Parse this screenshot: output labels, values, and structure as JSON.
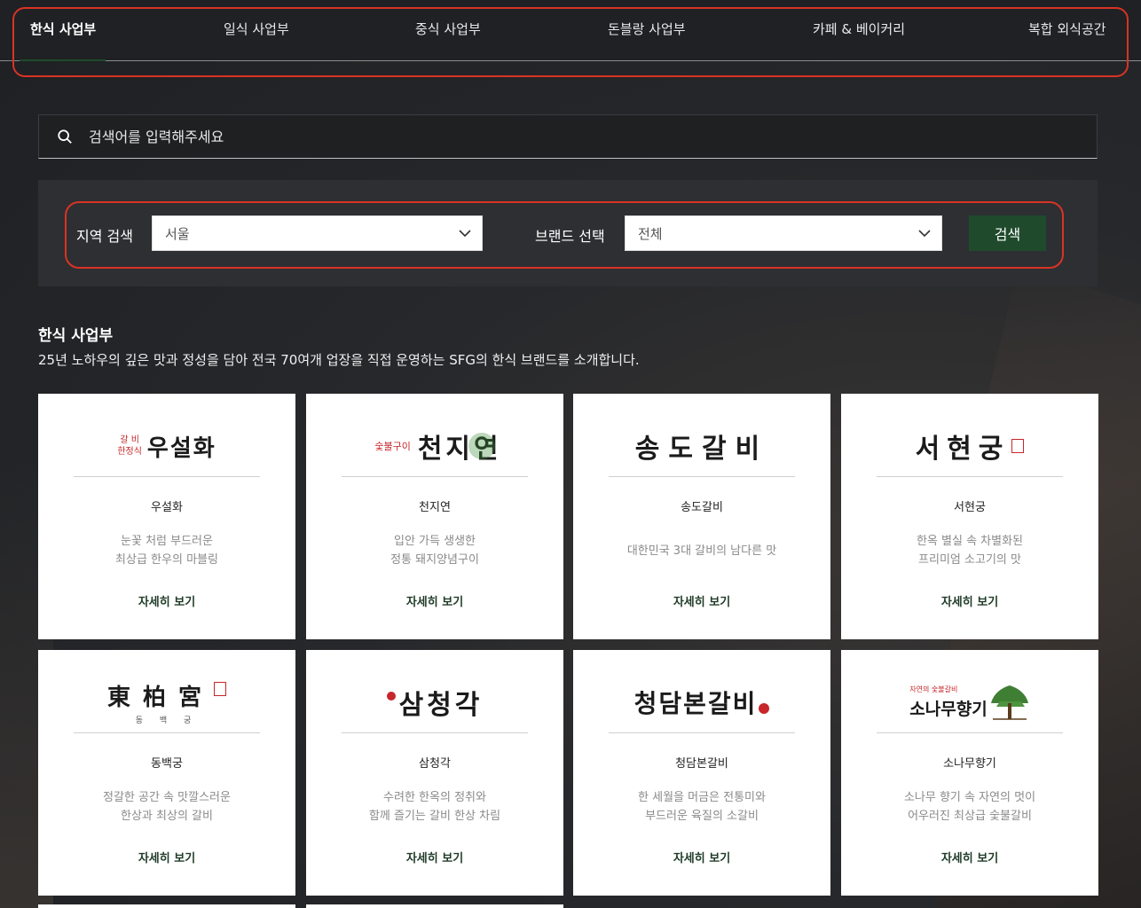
{
  "nav": {
    "tabs": [
      {
        "label": "한식 사업부",
        "active": true
      },
      {
        "label": "일식 사업부",
        "active": false
      },
      {
        "label": "중식 사업부",
        "active": false
      },
      {
        "label": "돈블랑 사업부",
        "active": false
      },
      {
        "label": "카페 & 베이커리",
        "active": false
      },
      {
        "label": "복합 외식공간",
        "active": false
      }
    ]
  },
  "search": {
    "placeholder": "검색어를 입력해주세요",
    "icon": "search-icon"
  },
  "filter": {
    "region_label": "지역 검색",
    "region_value": "서울",
    "brand_label": "브랜드 선택",
    "brand_value": "전체",
    "search_button": "검색"
  },
  "section": {
    "title": "한식 사업부",
    "description": "25년 노하우의 깊은 맛과 정성을 담아 전국 70여개 업장을 직접 운영하는 SFG의 한식 브랜드를 소개합니다."
  },
  "colors": {
    "accent": "#1f4b2c",
    "highlight": "#d93325"
  },
  "brands": [
    {
      "name": "우설화",
      "desc": [
        "눈꽃 처럼 부드러운",
        "최상급 한우의 마블링"
      ],
      "link": "자세히 보기",
      "logo": {
        "main": "우설화",
        "sub1": "갈 비",
        "sub2": "한정식"
      }
    },
    {
      "name": "천지연",
      "desc": [
        "입안 가득 생생한",
        "정통 돼지양념구이"
      ],
      "link": "자세히 보기",
      "logo": {
        "main": "천지연",
        "sub1": "숯불구이"
      }
    },
    {
      "name": "송도갈비",
      "desc": [
        "대한민국 3대 갈비의 남다른 맛"
      ],
      "link": "자세히 보기",
      "logo": {
        "main": "송도갈비"
      }
    },
    {
      "name": "서현궁",
      "desc": [
        "한옥 별실 속 차별화된",
        "프리미엄 소고기의 맛"
      ],
      "link": "자세히 보기",
      "logo": {
        "main": "서현궁"
      }
    },
    {
      "name": "동백궁",
      "desc": [
        "정갈한 공간 속 맛깔스러운",
        "한상과 최상의 갈비"
      ],
      "link": "자세히 보기",
      "logo": {
        "main": "東柏宮",
        "sub1": "동 백 궁"
      }
    },
    {
      "name": "삼청각",
      "desc": [
        "수려한 한옥의 정취와",
        "함께 즐기는 갈비 한상 차림"
      ],
      "link": "자세히 보기",
      "logo": {
        "main": "삼청각"
      }
    },
    {
      "name": "청담본갈비",
      "desc": [
        "한 세월을 머금은 전통미와",
        "부드러운 육질의 소갈비"
      ],
      "link": "자세히 보기",
      "logo": {
        "main": "청담본갈비"
      }
    },
    {
      "name": "소나무향기",
      "desc": [
        "소나무 향기 속 자연의 멋이",
        "어우러진 최상급 숯불갈비"
      ],
      "link": "자세히 보기",
      "logo": {
        "main": "소나무향기",
        "sub1": "자연의 숯불갈비"
      }
    }
  ]
}
